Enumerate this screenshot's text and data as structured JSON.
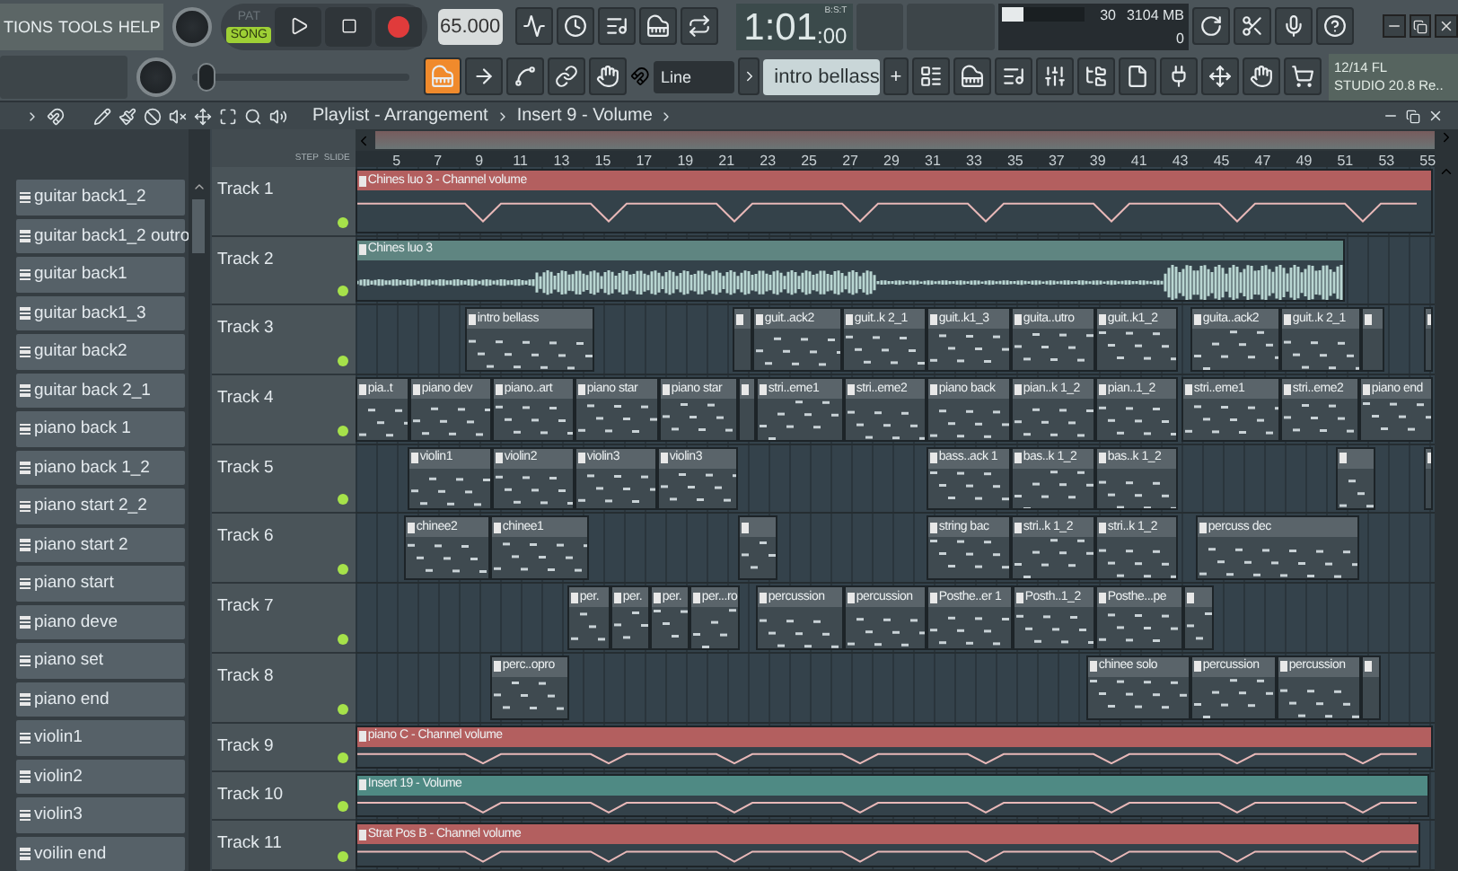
{
  "menu": {
    "items": [
      "TIONS",
      "TOOLS",
      "HELP"
    ]
  },
  "transport": {
    "modes": [
      {
        "label": "PAT",
        "selected": false
      },
      {
        "label": "SONG",
        "selected": true
      }
    ],
    "recording": true,
    "tempo": "65.000"
  },
  "time": {
    "main": "1:01",
    "sub": ":00",
    "unit": "B:S:T"
  },
  "cpu": {
    "level": 0.28,
    "reading": "30",
    "memory": "3104 MB",
    "polyphony": "0"
  },
  "snap": {
    "value": "Line"
  },
  "pattern_selector": {
    "value": "intro bellass",
    "add": "+"
  },
  "hint_panel": {
    "line_1": "12/14  FL",
    "line_2": "STUDIO 20.8 Re.."
  },
  "main_slider": {
    "level": 0.03
  },
  "breadcrumb": [
    "Playlist - Arrangement",
    "Insert 9 - Volume"
  ],
  "header_labels": {
    "step": "STEP",
    "slide": "SLIDE"
  },
  "ruler": [
    "5",
    "7",
    "9",
    "11",
    "13",
    "15",
    "17",
    "19",
    "21",
    "23",
    "25",
    "27",
    "29",
    "31",
    "33",
    "35",
    "37",
    "39",
    "41",
    "43",
    "45",
    "47",
    "49",
    "51",
    "53",
    "55"
  ],
  "browser": {
    "items": [
      "guitar back1_2",
      "guitar back1_2 outro",
      "guitar back1",
      "guitar back1_3",
      "guitar back2",
      "guitar back 2_1",
      "piano back 1",
      "piano back 1_2",
      "piano start 2_2",
      "piano start 2",
      "piano start",
      "piano deve",
      "piano set",
      "piano end",
      "violin1",
      "violin2",
      "violin3",
      "voilin end"
    ]
  },
  "tracks": [
    {
      "name": "Track 1",
      "enabled": true,
      "clips": [
        {
          "kind": "automation",
          "name": "Chines luo 3 - Channel volume",
          "color": "#b35f5f"
        }
      ]
    },
    {
      "name": "Track 2",
      "enabled": true,
      "clips": [
        {
          "kind": "audio",
          "name": "Chines luo 3",
          "color": "#5f8581"
        }
      ]
    },
    {
      "name": "Track 3",
      "enabled": true,
      "clips": [
        {
          "kind": "pattern",
          "name": "intro bellass"
        },
        {
          "kind": "pattern"
        },
        {
          "kind": "pattern",
          "name": "guit..ack2"
        },
        {
          "kind": "pattern",
          "name": "guit..k 2_1"
        },
        {
          "kind": "pattern",
          "name": "guit..k1_3"
        },
        {
          "kind": "pattern",
          "name": "guita..utro"
        },
        {
          "kind": "pattern",
          "name": "guit..k1_2"
        },
        {
          "kind": "pattern",
          "name": "guita..ack2"
        },
        {
          "kind": "pattern",
          "name": "guit..k 2_1"
        },
        {
          "kind": "pattern"
        },
        {
          "kind": "pattern"
        }
      ]
    },
    {
      "name": "Track 4",
      "enabled": true,
      "clips": [
        {
          "kind": "pattern",
          "name": "pia..t"
        },
        {
          "kind": "pattern",
          "name": "piano dev"
        },
        {
          "kind": "pattern",
          "name": "piano..art"
        },
        {
          "kind": "pattern",
          "name": "piano star"
        },
        {
          "kind": "pattern",
          "name": "piano star"
        },
        {
          "kind": "pattern"
        },
        {
          "kind": "pattern",
          "name": "stri..eme1"
        },
        {
          "kind": "pattern",
          "name": "stri..eme2"
        },
        {
          "kind": "pattern",
          "name": "piano back"
        },
        {
          "kind": "pattern",
          "name": "pian..k 1_2"
        },
        {
          "kind": "pattern",
          "name": "pian..1_2"
        },
        {
          "kind": "pattern",
          "name": "stri..eme1"
        },
        {
          "kind": "pattern",
          "name": "stri..eme2"
        },
        {
          "kind": "pattern",
          "name": "piano end"
        }
      ]
    },
    {
      "name": "Track 5",
      "enabled": true,
      "clips": [
        {
          "kind": "pattern",
          "name": "violin1"
        },
        {
          "kind": "pattern",
          "name": "violin2"
        },
        {
          "kind": "pattern",
          "name": "violin3"
        },
        {
          "kind": "pattern",
          "name": "violin3"
        },
        {
          "kind": "pattern",
          "name": "bass..ack 1"
        },
        {
          "kind": "pattern",
          "name": "bas..k 1_2"
        },
        {
          "kind": "pattern",
          "name": "bas..k 1_2"
        },
        {
          "kind": "pattern"
        },
        {
          "kind": "pattern"
        }
      ]
    },
    {
      "name": "Track 6",
      "enabled": true,
      "clips": [
        {
          "kind": "pattern",
          "name": "chinee2"
        },
        {
          "kind": "pattern",
          "name": "chinee1"
        },
        {
          "kind": "pattern"
        },
        {
          "kind": "pattern",
          "name": "string bac"
        },
        {
          "kind": "pattern",
          "name": "stri..k 1_2"
        },
        {
          "kind": "pattern",
          "name": "stri..k 1_2"
        },
        {
          "kind": "pattern",
          "name": "percuss dec"
        }
      ]
    },
    {
      "name": "Track 7",
      "enabled": true,
      "clips": [
        {
          "kind": "pattern",
          "name": "per."
        },
        {
          "kind": "pattern",
          "name": "per."
        },
        {
          "kind": "pattern",
          "name": "per."
        },
        {
          "kind": "pattern",
          "name": "per...ro"
        },
        {
          "kind": "pattern",
          "name": "percussion"
        },
        {
          "kind": "pattern",
          "name": "percussion"
        },
        {
          "kind": "pattern",
          "name": "Posthe..er 1"
        },
        {
          "kind": "pattern",
          "name": "Posth..1_2"
        },
        {
          "kind": "pattern",
          "name": "Posthe...pe"
        },
        {
          "kind": "pattern"
        }
      ]
    },
    {
      "name": "Track 8",
      "enabled": true,
      "clips": [
        {
          "kind": "pattern",
          "name": "perc..opro"
        },
        {
          "kind": "pattern",
          "name": "chinee solo"
        },
        {
          "kind": "pattern",
          "name": "percussion"
        },
        {
          "kind": "pattern",
          "name": "percussion"
        },
        {
          "kind": "pattern"
        }
      ]
    },
    {
      "name": "Track 9",
      "enabled": true,
      "clips": [
        {
          "kind": "automation",
          "name": "piano C - Channel volume",
          "color": "#b35f5f"
        }
      ]
    },
    {
      "name": "Track 10",
      "enabled": true,
      "clips": [
        {
          "kind": "automation",
          "name": "Insert 19 - Volume",
          "color": "#4f8a84"
        }
      ]
    },
    {
      "name": "Track 11",
      "enabled": true,
      "clips": [
        {
          "kind": "automation",
          "name": "Strat Pos B - Channel volume",
          "color": "#b35f5f"
        }
      ]
    }
  ]
}
